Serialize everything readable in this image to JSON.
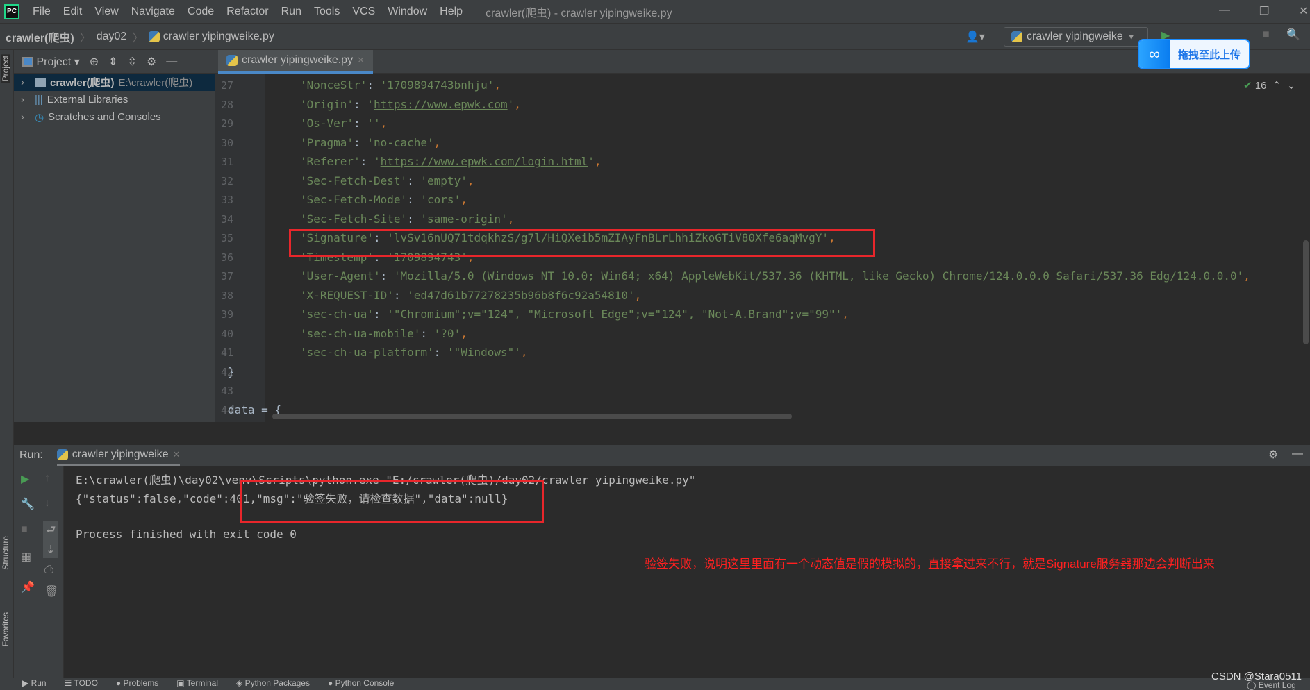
{
  "menu": {
    "items": [
      "File",
      "Edit",
      "View",
      "Navigate",
      "Code",
      "Refactor",
      "Run",
      "Tools",
      "VCS",
      "Window",
      "Help"
    ],
    "window_title": "crawler(爬虫) - crawler yipingweike.py"
  },
  "breadcrumb": [
    "crawler(爬虫)",
    "day02",
    "crawler yipingweike.py"
  ],
  "run_config": "crawler yipingweike",
  "project_panel": {
    "title": "Project",
    "items": [
      {
        "label": "crawler(爬虫)",
        "path": "E:\\crawler(爬虫)"
      },
      {
        "label": "External Libraries"
      },
      {
        "label": "Scratches and Consoles"
      }
    ]
  },
  "left_stripe": {
    "project": "Project",
    "structure": "Structure",
    "favorites": "Favorites"
  },
  "editor": {
    "tab": "crawler yipingweike.py",
    "inspection_count": "16",
    "lines": [
      {
        "num": "27",
        "key": "NonceStr",
        "val": "1709894743bnhju"
      },
      {
        "num": "28",
        "key": "Origin",
        "val": "https://www.epwk.com",
        "link": true
      },
      {
        "num": "29",
        "key": "Os-Ver",
        "val": ""
      },
      {
        "num": "30",
        "key": "Pragma",
        "val": "no-cache"
      },
      {
        "num": "31",
        "key": "Referer",
        "val": "https://www.epwk.com/login.html",
        "link": true
      },
      {
        "num": "32",
        "key": "Sec-Fetch-Dest",
        "val": "empty"
      },
      {
        "num": "33",
        "key": "Sec-Fetch-Mode",
        "val": "cors"
      },
      {
        "num": "34",
        "key": "Sec-Fetch-Site",
        "val": "same-origin"
      },
      {
        "num": "35",
        "key": "Signature",
        "val": "lvSv16nUQ71tdqkhzS/g7l/HiQXeib5mZIAyFnBLrLhhiZkoGTiV80Xfe6aqMvgY"
      },
      {
        "num": "36",
        "key": "Timestemp",
        "val": "1709894743"
      },
      {
        "num": "37",
        "key": "User-Agent",
        "val": "Mozilla/5.0 (Windows NT 10.0; Win64; x64) AppleWebKit/537.36 (KHTML, like Gecko) Chrome/124.0.0.0 Safari/537.36 Edg/124.0.0.0"
      },
      {
        "num": "38",
        "key": "X-REQUEST-ID",
        "val": "ed47d61b77278235b96b8f6c92a54810"
      },
      {
        "num": "39",
        "key": "sec-ch-ua",
        "val": "\"Chromium\";v=\"124\", \"Microsoft Edge\";v=\"124\", \"Not-A.Brand\";v=\"99\""
      },
      {
        "num": "40",
        "key": "sec-ch-ua-mobile",
        "val": "?0"
      },
      {
        "num": "41",
        "key": "sec-ch-ua-platform",
        "val": "\"Windows\""
      },
      {
        "num": "42",
        "raw": "}"
      },
      {
        "num": "43",
        "raw": ""
      },
      {
        "num": "44",
        "raw": "data = {"
      }
    ]
  },
  "baidu_upload": "拖拽至此上传",
  "run_panel": {
    "label": "Run:",
    "tab": "crawler yipingweike",
    "output": [
      "E:\\crawler(爬虫)\\day02\\venv\\Scripts\\python.exe \"E:/crawler(爬虫)/day02/crawler yipingweike.py\"",
      "{\"status\":false,\"code\":401,\"msg\":\"验签失败，请检查数据\",\"data\":null}",
      "",
      "Process finished with exit code 0"
    ]
  },
  "annotation": "验签失败，说明这里里面有一个动态值是假的模拟的，直接拿过来不行，就是Signature服务器那边会判断出来",
  "status_tabs": [
    "Run",
    "TODO",
    "Problems",
    "Terminal",
    "Python Packages",
    "Python Console"
  ],
  "event_log": "Event Log",
  "watermark": "CSDN @Stara0511",
  "colors": {
    "highlight_box": "#e8262b",
    "annotation": "#ff2020",
    "string": "#6a8759",
    "accent": "#4a88c7"
  }
}
